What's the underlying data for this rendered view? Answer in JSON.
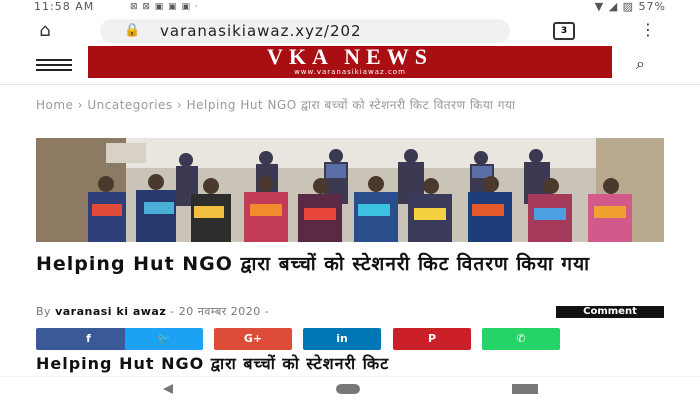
{
  "status": {
    "time": "11:58 AM",
    "icons": "⊠ ⊠ ▣ ▣ ▣ ·",
    "battery": "57%"
  },
  "browser": {
    "url": "varanasikiawaz.xyz/202",
    "tab_count": "3"
  },
  "site": {
    "logo_title": "VKA NEWS",
    "logo_tagline": "www.varanasikiawaz.com"
  },
  "breadcrumb": {
    "home": "Home",
    "sep": " › ",
    "category": "Uncategories",
    "current": "Helping Hut NGO द्वारा बच्चों को स्टेशनरी किट वितरण किया गया"
  },
  "article": {
    "title": "Helping Hut NGO द्वारा बच्चों को स्टेशनरी किट वितरण किया गया",
    "by": "By",
    "author": "varanasi ki awaz",
    "dash": " - ",
    "date": "20 नवम्बर 2020",
    "dash2": " - ",
    "comment_label": "Comment",
    "snippet": "Helping Hut NGO द्वारा बच्चों को स्टेशनरी किट"
  },
  "share_buttons": [
    {
      "label": "f",
      "color": "#3b5998"
    },
    {
      "label": "🐦",
      "color": "#1da1f2"
    },
    {
      "label": "G+",
      "color": "#dd4b39"
    },
    {
      "label": "in",
      "color": "#0077b5"
    },
    {
      "label": "P",
      "color": "#cb2027"
    },
    {
      "label": "✆",
      "color": "#25d366"
    }
  ]
}
